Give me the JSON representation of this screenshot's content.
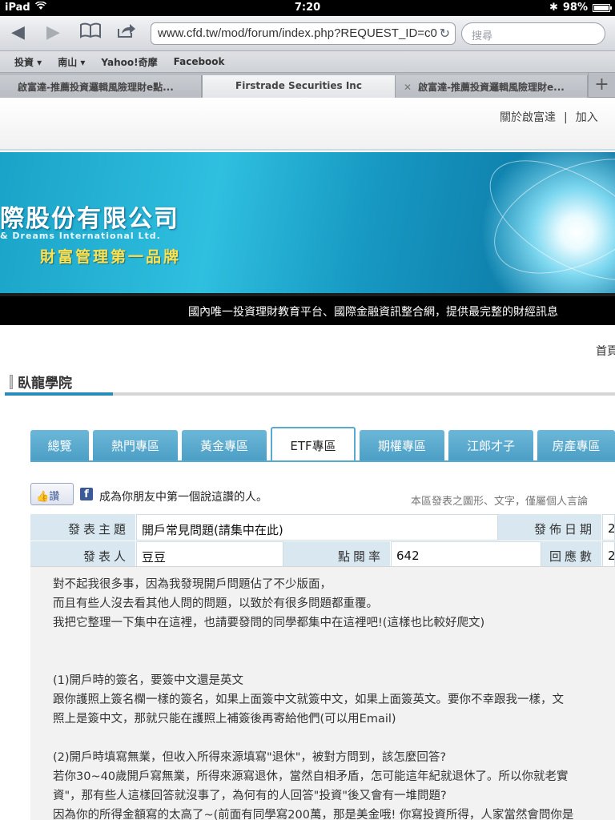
{
  "status_bar": {
    "device": "iPad",
    "time": "7:20",
    "battery": "98%",
    "battery_level": 0.98
  },
  "toolbar": {
    "url": "www.cfd.tw/mod/forum/index.php?REQUEST_ID=c0",
    "search_placeholder": "搜尋"
  },
  "bookmarks": [
    {
      "label": "投資 ▾"
    },
    {
      "label": "南山 ▾"
    },
    {
      "label": "Yahoo!奇摩"
    },
    {
      "label": "Facebook"
    }
  ],
  "tabs": [
    {
      "title": "啟富達-推薦投資邏輯風險理財e點...",
      "active": false
    },
    {
      "title": "Firstrade Securities Inc",
      "active": true
    },
    {
      "title": "啟富達-推薦投資邏輯風險理財e...",
      "active": false
    }
  ],
  "site_nav": {
    "about": "關於啟富達",
    "separator": "|",
    "join": "加入"
  },
  "banner": {
    "company": "際股份有限公司",
    "company_en": "& Dreams International Ltd.",
    "slogan": "財富管理第一品牌",
    "tagline": "國內唯一投資理財教育平台、國際金融資訊整合網，提供最完整的財經訊息"
  },
  "home_link": "首頁",
  "section": {
    "title": "臥龍學院"
  },
  "categories": [
    {
      "label": "總覽",
      "active": false
    },
    {
      "label": "熱門專區",
      "active": false
    },
    {
      "label": "黃金專區",
      "active": false
    },
    {
      "label": "ETF專區",
      "active": true
    },
    {
      "label": "期權專區",
      "active": false
    },
    {
      "label": "江郎才子",
      "active": false
    },
    {
      "label": "房產專區",
      "active": false
    }
  ],
  "social": {
    "like_label": "讚",
    "like_text": "成為你朋友中第一個說這讚的人。",
    "disclaimer": "本區發表之圖形、文字，僅屬個人言論"
  },
  "post_info": {
    "subject_label": "發表主題",
    "subject": "開戶常見問題(請集中在此)",
    "date_label": "發佈日期",
    "date_partial": "2",
    "author_label": "發表人",
    "author": "豆豆",
    "views_label": "點閱率",
    "views": "642",
    "replies_label": "回應數",
    "replies_partial": "2"
  },
  "post_body": {
    "lines": [
      "對不起我很多事，因為我發現開戶問題佔了不少版面，",
      "而且有些人沒去看其他人問的問題，以致於有很多問題都重覆。",
      "我把它整理一下集中在這裡，也請要發問的同學都集中在這裡吧!(這樣也比較好爬文)",
      "",
      "",
      "(1)開戶時的簽名，要簽中文還是英文",
      "跟你護照上簽名欄一樣的簽名，如果上面簽中文就簽中文，如果上面簽英文。要你不幸跟我一樣，文",
      "照上是簽中文，那就只能在護照上補簽後再寄給他們(可以用Email)",
      "",
      "(2)開戶時填寫無業，但收入所得來源填寫\"退休\"，被對方問到，該怎麼回答?",
      "若你30~40歲開戶寫無業，所得來源寫退休，當然自相矛盾，怎可能這年紀就退休了。所以你就老實",
      "資\"，那有些人這樣回答就沒事了，為何有的人回答\"投資\"後又會有一堆問題?",
      "因為你的所得金額寫的太高了~(前面有同學寫200萬，那是美金哦! 你寫投資所得，人家當然會問你是"
    ]
  }
}
